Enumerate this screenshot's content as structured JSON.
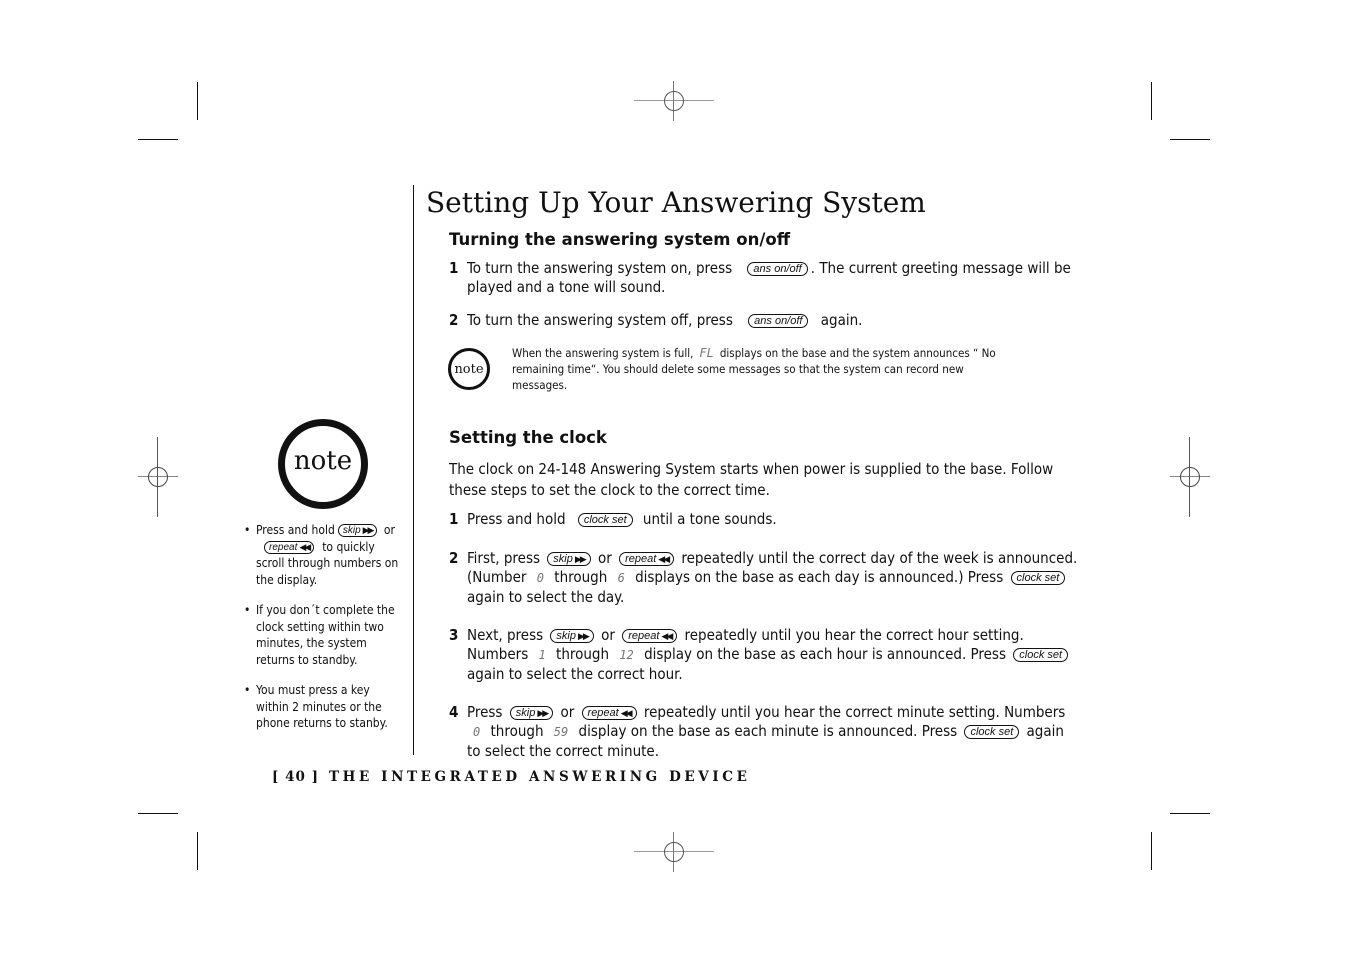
{
  "page": {
    "title": "Setting Up Your Answering System",
    "footer": {
      "page_number": "[ 40 ]",
      "section": "THE INTEGRATED ANSWERING DEVICE"
    }
  },
  "keys": {
    "ans": "ans on/off",
    "clock": "clock set",
    "skip": "skip",
    "skip_arrow": "▶▶",
    "repeat": "repeat",
    "repeat_arrow": "◀◀"
  },
  "section1": {
    "heading": "Turning the answering system on/off",
    "steps": [
      {
        "num": "1",
        "before": "To turn the answering system on, press",
        "after": ". The current greeting message will be played and a tone will sound."
      },
      {
        "num": "2",
        "before": "To turn the answering system off, press",
        "after": " again."
      }
    ],
    "note": {
      "icon_label": "note",
      "before": "When the answering system is full,",
      "lcd": "FL",
      "after": "displays on the base and the system announces “ No remaining time“. You should delete some messages so that the system can record new messages."
    }
  },
  "section2": {
    "heading": "Setting the clock",
    "intro": "The clock on 24-148 Answering System starts when power is supplied to the base. Follow these steps to set the clock to the correct time.",
    "steps": [
      {
        "num": "1",
        "before": "Press and hold",
        "after": " until a tone sounds."
      },
      {
        "num": "2",
        "a": "First, press",
        "or": "or",
        "b": "repeatedly until the correct day of the week is announced. (Number",
        "lcd1": "0",
        "through": "through",
        "lcd2": "6",
        "c": "displays on the base as each day is announced.) Press",
        "d": "again to select the day."
      },
      {
        "num": "3",
        "a": "Next, press",
        "or": "or",
        "b": "repeatedly until you hear the correct hour setting. Numbers",
        "lcd1": "1",
        "through": "through",
        "lcd2": "12",
        "c": "display on the base as each hour is announced. Press",
        "d": "again to select the correct hour."
      },
      {
        "num": "4",
        "a": "Press",
        "or": "or",
        "b": "repeatedly until you hear the correct minute setting. Numbers",
        "lcd1": "0",
        "through": "through",
        "lcd2": "59",
        "c": "display on the base as each minute is announced. Press",
        "d": "again to select the correct minute."
      }
    ]
  },
  "sidebar": {
    "icon_label": "note",
    "bullet": "•",
    "items": [
      {
        "a": "Press and hold",
        "or": "or",
        "b": "to quickly scroll through numbers on the display."
      },
      {
        "text": "If you don´t complete the clock setting within two minutes, the system returns to standby."
      },
      {
        "text": "You must press a key within 2 minutes or the phone returns to stanby."
      }
    ]
  }
}
